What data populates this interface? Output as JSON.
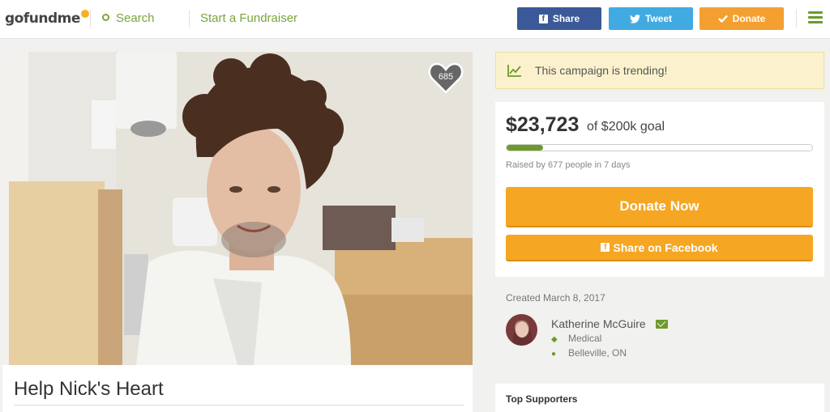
{
  "header": {
    "logo": "gofundme",
    "search_label": "Search",
    "start_label": "Start a Fundraiser",
    "share_label": "Share",
    "tweet_label": "Tweet",
    "donate_label": "Donate"
  },
  "campaign": {
    "title": "Help Nick's Heart",
    "heart_count": "685"
  },
  "trending": {
    "text": "This campaign is trending!"
  },
  "donation": {
    "amount": "$23,723",
    "goal": "of $200k goal",
    "progress": 0.12,
    "raised_text": "Raised by 677 people in 7 days",
    "donate_now_label": "Donate Now",
    "share_facebook_label": "Share on Facebook"
  },
  "organizer": {
    "created": "Created March 8, 2017",
    "name": "Katherine McGuire",
    "category": "Medical",
    "location": "Belleville, ON"
  },
  "supporters": {
    "title": "Top Supporters"
  },
  "colors": {
    "brand_green": "#6e9a2c",
    "donate_orange": "#f5a623",
    "facebook_blue": "#3b5998",
    "twitter_blue": "#41abe1"
  },
  "icons": [
    "search-icon",
    "facebook-icon",
    "twitter-icon",
    "check-icon",
    "menu-icon",
    "heart-icon",
    "trending-icon",
    "mail-icon",
    "tag-icon",
    "location-icon"
  ]
}
